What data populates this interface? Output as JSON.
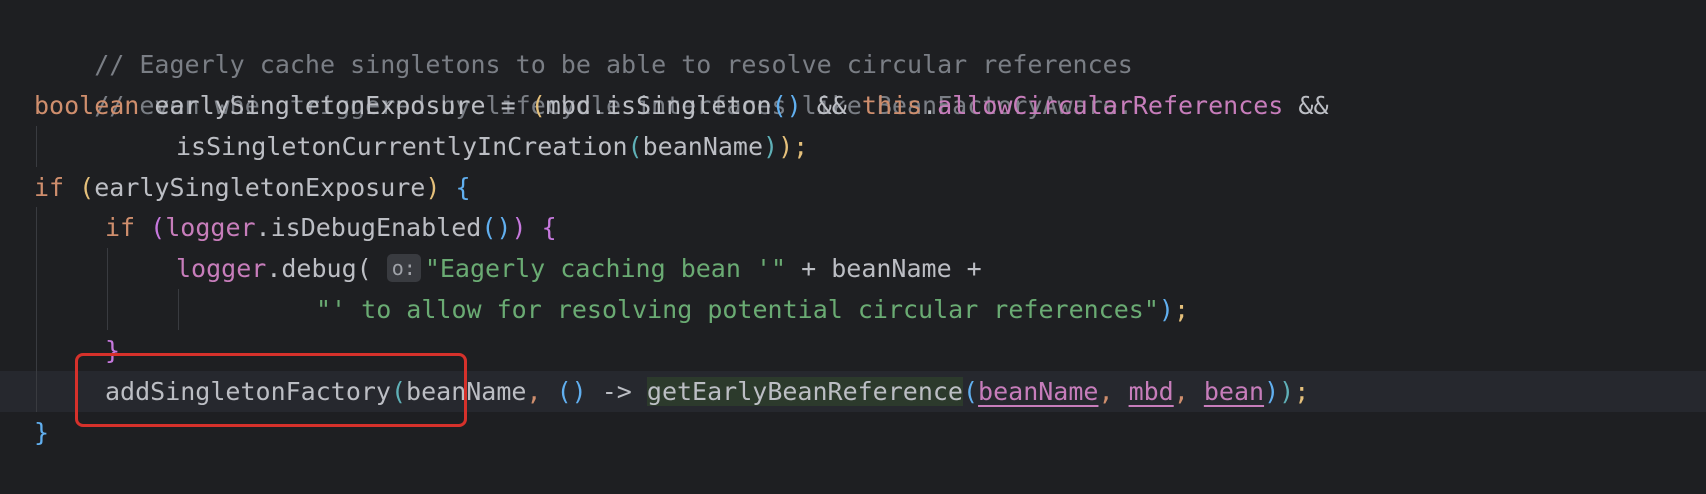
{
  "editor": {
    "lines": [
      {
        "comment": "// Eagerly cache singletons to be able to resolve circular references"
      },
      {
        "comment": "// even when triggered by lifecycle interfaces like BeanFactoryAware."
      },
      {
        "kw_boolean": "boolean",
        "var": "earlySingletonExposure",
        "eq": " = ",
        "paren_open": "(",
        "mbd_call": "mbd.isSingleton",
        "call_parens": "()",
        "and1": " && ",
        "kw_this": "this",
        "dot": ".",
        "field": "allowCircularReferences",
        "and2": " &&"
      },
      {
        "method": "isSingletonCurrentlyInCreation",
        "paren_open": "(",
        "arg": "beanName",
        "paren_close": ")",
        "close": ");"
      },
      {
        "kw_if": "if",
        "space": " ",
        "paren_open": "(",
        "cond": "earlySingletonExposure",
        "paren_close": ")",
        "brace": "{"
      },
      {
        "kw_if": "if",
        "paren_open": "(",
        "logger": "logger",
        "call": ".isDebugEnabled",
        "call_parens": "()",
        "paren_close": ")",
        "brace": "{"
      },
      {
        "logger": "logger",
        "call": ".debug(",
        "hint": "o:",
        "str": "\"Eagerly caching bean '\"",
        "rest": " + beanName +"
      },
      {
        "str": "\"' to allow for resolving potential circular references\"",
        "close_paren": ")",
        "semi": ";"
      },
      {
        "brace": "}"
      },
      {
        "method": "addSingletonFactory",
        "paren_open": "(",
        "arg1": "beanName",
        "comma1": ", ",
        "lambda": "()",
        "arrow": " -> ",
        "ref_method": "getEarlyBeanReference",
        "inner_open": "(",
        "a1": "beanName",
        "c1": ", ",
        "a2": "mbd",
        "c2": ", ",
        "a3": "bean",
        "inner_close": ")",
        "outer_close": ")",
        "semi": ";"
      },
      {
        "brace": "}"
      }
    ],
    "highlight_color": "#d6312b"
  }
}
